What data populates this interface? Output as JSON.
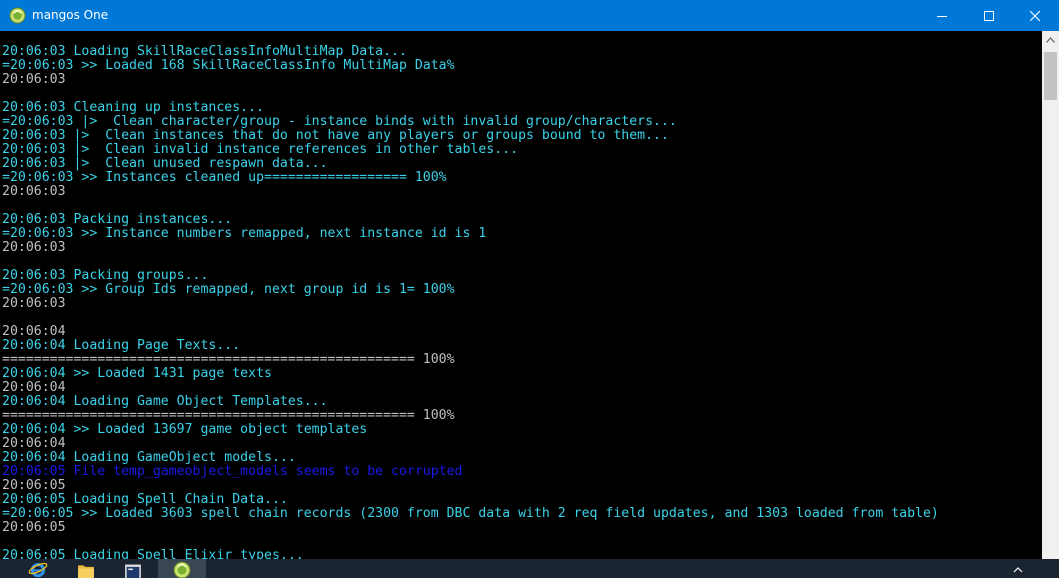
{
  "window": {
    "title": "mangos One",
    "icons": {
      "app": "mangos-app-icon",
      "minimize": "minimize-icon",
      "maximize": "maximize-icon",
      "close": "close-icon"
    }
  },
  "colors": {
    "titlebar": "#0078d7",
    "console_background": "#000000",
    "text_cyan": "#3ad2e8",
    "text_gray": "#c0c0c0",
    "text_blue": "#1a1ae6",
    "scrollbar_track": "#f0f0f0",
    "scrollbar_thumb": "#c2c2c2",
    "taskbar": "#1b2431"
  },
  "console": {
    "lines": [
      {
        "text": "20:06:03 Loading SkillRaceClassInfoMultiMap Data...",
        "color": "cyan"
      },
      {
        "text": "=20:06:03 >> Loaded 168 SkillRaceClassInfo MultiMap Data%",
        "color": "cyan"
      },
      {
        "text": "20:06:03",
        "color": "gray"
      },
      {
        "text": "",
        "color": "gray"
      },
      {
        "text": "20:06:03 Cleaning up instances...",
        "color": "cyan"
      },
      {
        "text": "=20:06:03 |>  Clean character/group - instance binds with invalid group/characters...",
        "color": "cyan"
      },
      {
        "text": "20:06:03 |>  Clean instances that do not have any players or groups bound to them...",
        "color": "cyan"
      },
      {
        "text": "20:06:03 |>  Clean invalid instance references in other tables...",
        "color": "cyan"
      },
      {
        "text": "20:06:03 |>  Clean unused respawn data...",
        "color": "cyan"
      },
      {
        "text": "=20:06:03 >> Instances cleaned up================== 100%",
        "color": "cyan"
      },
      {
        "text": "20:06:03",
        "color": "gray"
      },
      {
        "text": "",
        "color": "gray"
      },
      {
        "text": "20:06:03 Packing instances...",
        "color": "cyan"
      },
      {
        "text": "=20:06:03 >> Instance numbers remapped, next instance id is 1",
        "color": "cyan"
      },
      {
        "text": "20:06:03",
        "color": "gray"
      },
      {
        "text": "",
        "color": "gray"
      },
      {
        "text": "20:06:03 Packing groups...",
        "color": "cyan"
      },
      {
        "text": "=20:06:03 >> Group Ids remapped, next group id is 1= 100%",
        "color": "cyan"
      },
      {
        "text": "20:06:03",
        "color": "gray"
      },
      {
        "text": "",
        "color": "gray"
      },
      {
        "text": "20:06:04",
        "color": "gray"
      },
      {
        "text": "20:06:04 Loading Page Texts...",
        "color": "cyan"
      },
      {
        "text": "==================================================== 100%",
        "color": "gray"
      },
      {
        "text": "20:06:04 >> Loaded 1431 page texts",
        "color": "cyan"
      },
      {
        "text": "20:06:04",
        "color": "gray"
      },
      {
        "text": "20:06:04 Loading Game Object Templates...",
        "color": "cyan"
      },
      {
        "text": "==================================================== 100%",
        "color": "gray"
      },
      {
        "text": "20:06:04 >> Loaded 13697 game object templates",
        "color": "cyan"
      },
      {
        "text": "20:06:04",
        "color": "gray"
      },
      {
        "text": "20:06:04 Loading GameObject models...",
        "color": "cyan"
      },
      {
        "text": "20:06:05 File temp_gameobject_models seems to be corrupted",
        "color": "blue"
      },
      {
        "text": "20:06:05",
        "color": "gray"
      },
      {
        "text": "20:06:05 Loading Spell Chain Data...",
        "color": "cyan"
      },
      {
        "text": "=20:06:05 >> Loaded 3603 spell chain records (2300 from DBC data with 2 req field updates, and 1303 loaded from table)",
        "color": "cyan"
      },
      {
        "text": "20:06:05",
        "color": "gray"
      },
      {
        "text": "",
        "color": "gray"
      },
      {
        "text": "20:06:05 Loading Spell Elixir types...",
        "color": "cyan"
      }
    ]
  },
  "taskbar": {
    "items": [
      {
        "name": "internet-explorer-icon"
      },
      {
        "name": "file-explorer-icon"
      },
      {
        "name": "console-window-icon"
      },
      {
        "name": "mangos-app-icon"
      }
    ]
  }
}
